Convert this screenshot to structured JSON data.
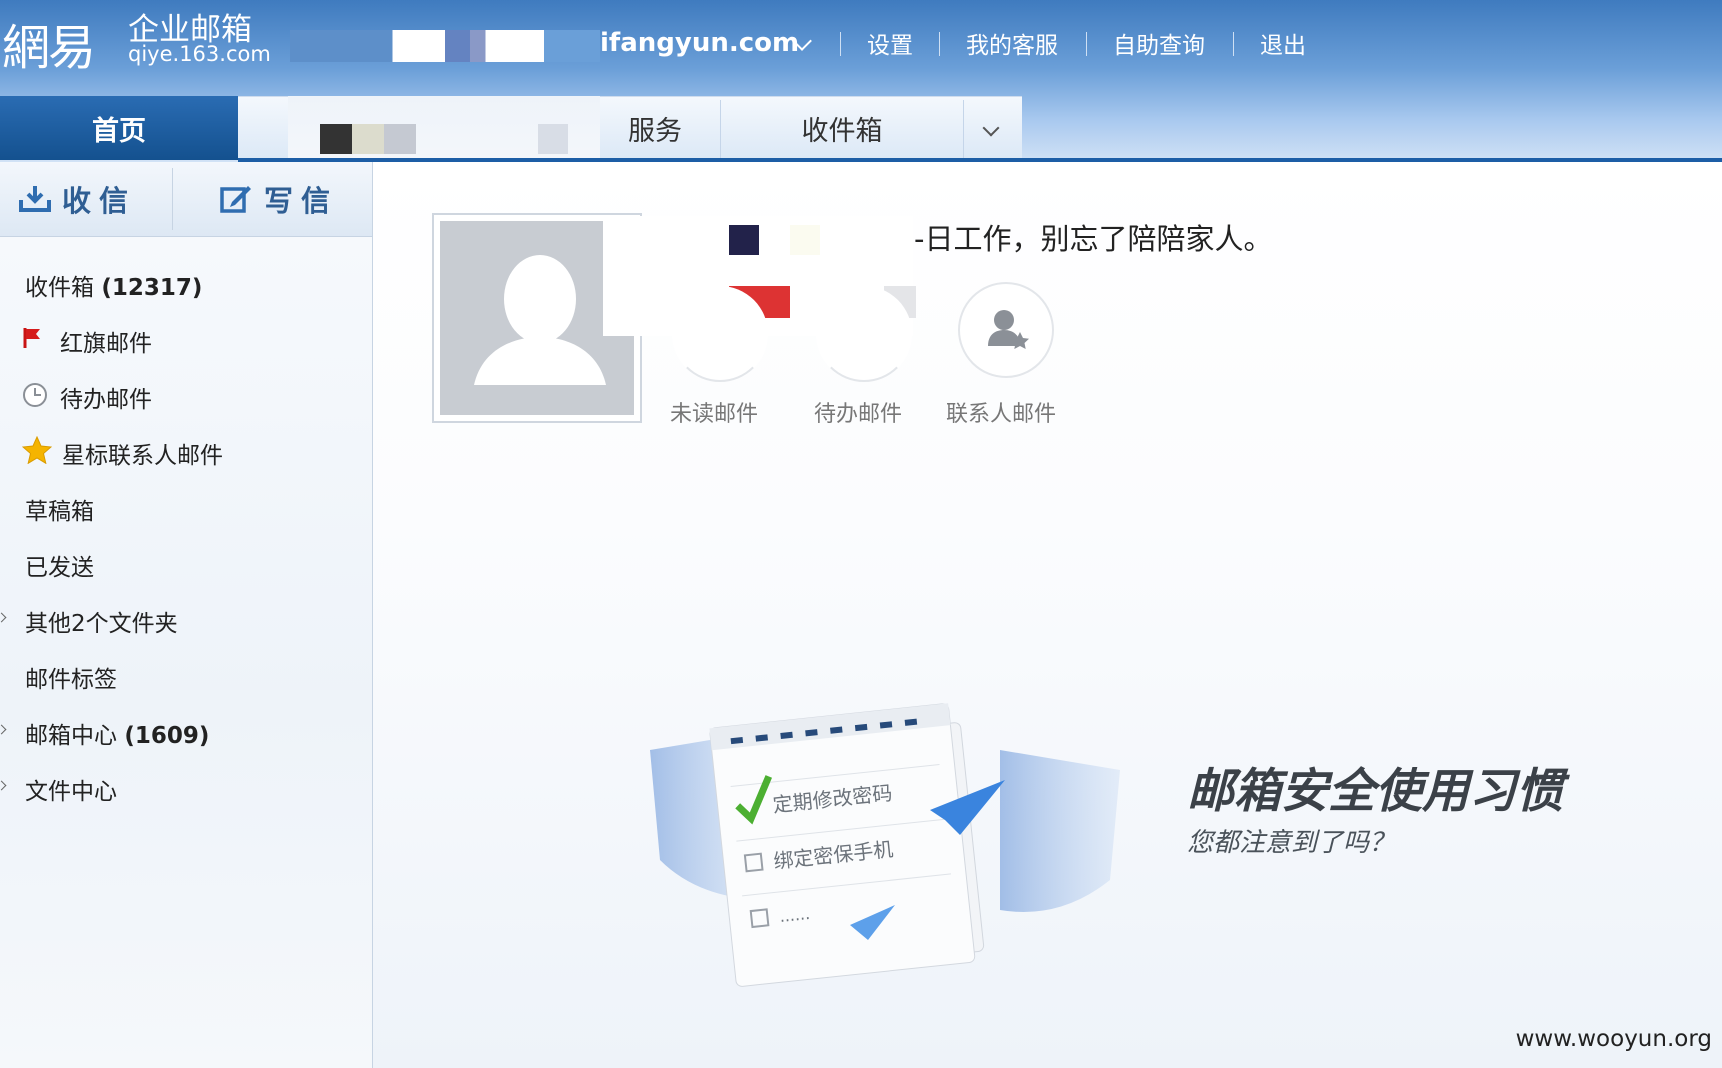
{
  "header": {
    "logo_big": "網易",
    "logo_cn": "企业邮箱",
    "logo_en": "qiye.163.com",
    "domain": "ifangyun.com",
    "links": [
      "设置",
      "我的客服",
      "自助查询",
      "退出"
    ]
  },
  "tabs": [
    {
      "label": "首页",
      "active": true
    },
    {
      "label": "服务",
      "active": false
    },
    {
      "label": "收件箱",
      "active": false
    }
  ],
  "sidebar": {
    "receive_label": "收信",
    "compose_label": "写信",
    "items": [
      {
        "label": "收件箱 ",
        "count": "(12317)"
      },
      {
        "label": "红旗邮件",
        "icon": "red-flag-icon"
      },
      {
        "label": "待办邮件",
        "icon": "clock-icon"
      },
      {
        "label": "星标联系人邮件",
        "icon": "star-icon"
      },
      {
        "label": "草稿箱"
      },
      {
        "label": "已发送"
      },
      {
        "label": "其他2个文件夹",
        "expandable": true
      },
      {
        "label": "邮件标签"
      },
      {
        "label": "邮箱中心 ",
        "count": "(1609)",
        "expandable": true
      },
      {
        "label": "文件中心",
        "expandable": true
      }
    ]
  },
  "main": {
    "greeting": "-日工作，别忘了陪陪家人。",
    "quick": [
      {
        "label": "未读邮件"
      },
      {
        "label": "待办邮件"
      },
      {
        "label": "联系人邮件",
        "icon": "contact-star-icon"
      }
    ],
    "security_banner": {
      "title": "邮箱安全使用习惯",
      "subtitle": "您都注意到了吗？",
      "checklist": [
        "定期修改密码",
        "绑定密保手机",
        "......"
      ]
    },
    "watermark": "www.wooyun.org"
  },
  "colors": {
    "top_blue": "#3f7bbf",
    "tab_active": "#1d5ea6",
    "text": "#222222",
    "muted": "#777777"
  }
}
